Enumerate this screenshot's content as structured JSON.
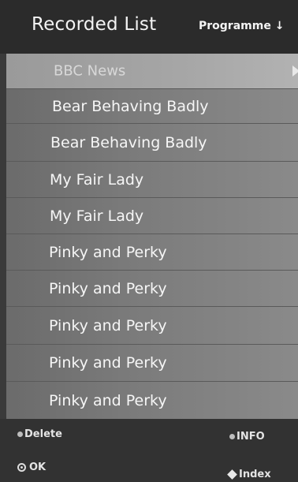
{
  "header": {
    "title": "Recorded List",
    "sort_label": "Programme ↓"
  },
  "recordings": [
    {
      "title": "BBC News",
      "selected": true
    },
    {
      "title": "Bear Behaving Badly",
      "selected": false
    },
    {
      "title": "Bear Behaving Badly",
      "selected": false
    },
    {
      "title": "My Fair Lady",
      "selected": false
    },
    {
      "title": "My Fair Lady",
      "selected": false
    },
    {
      "title": "Pinky and Perky",
      "selected": false
    },
    {
      "title": "Pinky and Perky",
      "selected": false
    },
    {
      "title": "Pinky and Perky",
      "selected": false
    },
    {
      "title": "Pinky and Perky",
      "selected": false
    },
    {
      "title": "Pinky and Perky",
      "selected": false
    }
  ],
  "footer": {
    "delete_label": "Delete",
    "info_label": "INFO",
    "ok_label": "OK",
    "index_label": "Index"
  },
  "icons": {
    "selection_arrow": "arrow-right-icon",
    "delete_key": "bullet-icon",
    "info_key": "bullet-icon",
    "ok_key": "ok-ring-icon",
    "index_key": "diamond-icon"
  }
}
